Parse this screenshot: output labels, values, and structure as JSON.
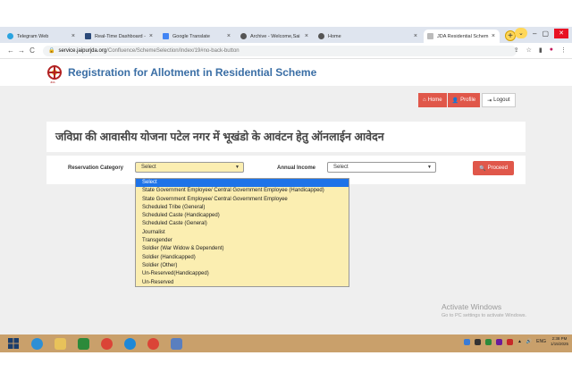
{
  "browser": {
    "tabs": [
      {
        "label": "Telegram Web",
        "color": "#2aa3e0"
      },
      {
        "label": "Real-Time Dashboard -",
        "color": "#2b4a7a"
      },
      {
        "label": "Google Translate",
        "color": "#4285f4"
      },
      {
        "label": "Archive - Welcome,Sai",
        "color": "#555555"
      },
      {
        "label": "Home",
        "color": "#555555"
      },
      {
        "label": "JDA Residential Schem",
        "color": "#888888"
      }
    ],
    "new_tab_label": "+",
    "url_domain": "service.jaipurjda.org",
    "url_path": "/Confluence/SchemeSelection/Index/19#no-back-button",
    "back_label": "←",
    "forward_label": "→",
    "reload_label": "C",
    "minimize_label": "–",
    "maximize_label": "▢",
    "close_label": "✕",
    "chevron_label": "⌄"
  },
  "site": {
    "title": "Registration for Allotment in Residential Scheme",
    "logo_text": "JDA",
    "home_label": "Home",
    "profile_label": "Profile",
    "logout_label": "Logout"
  },
  "form": {
    "heading": "जविप्रा की आवासीय योजना पटेल नगर में भूखंडो के आवंटन हेतु ऑनलाईन आवेदन",
    "reservation_label": "Reservation Category",
    "reservation_value": "Select",
    "income_label": "Annual Income",
    "income_value": "Select",
    "proceed_label": "Proceed",
    "reservation_options": [
      "Select",
      "State Government Employee/ Central Government Employee (Handicapped)",
      "State Government Employee/ Central Government Employee",
      "Scheduled Tribe (General)",
      "Scheduled Caste (Handicapped)",
      "Scheduled Caste (General)",
      "Journalist",
      "Transgender",
      "Soldier (War Widow & Dependent)",
      "Soldier (Handicapped)",
      "Soldier (Other)",
      "Un-Reserved(Handicapped)",
      "Un-Reserved"
    ]
  },
  "os": {
    "watermark_title": "Activate Windows",
    "watermark_sub": "Go to PC settings to activate Windows.",
    "lang": "ENG",
    "time": "2:38 PM",
    "date": "1/15/2025",
    "taskbar_apps": [
      {
        "name": "ie",
        "color": "#2d8fd5"
      },
      {
        "name": "explorer",
        "color": "#e8c25a"
      },
      {
        "name": "app-green",
        "color": "#2c8a3a"
      },
      {
        "name": "chrome",
        "color": "#db4437"
      },
      {
        "name": "edge",
        "color": "#1e88d8"
      },
      {
        "name": "chrome-2",
        "color": "#db4437"
      },
      {
        "name": "paint",
        "color": "#5a7fbf"
      }
    ]
  }
}
